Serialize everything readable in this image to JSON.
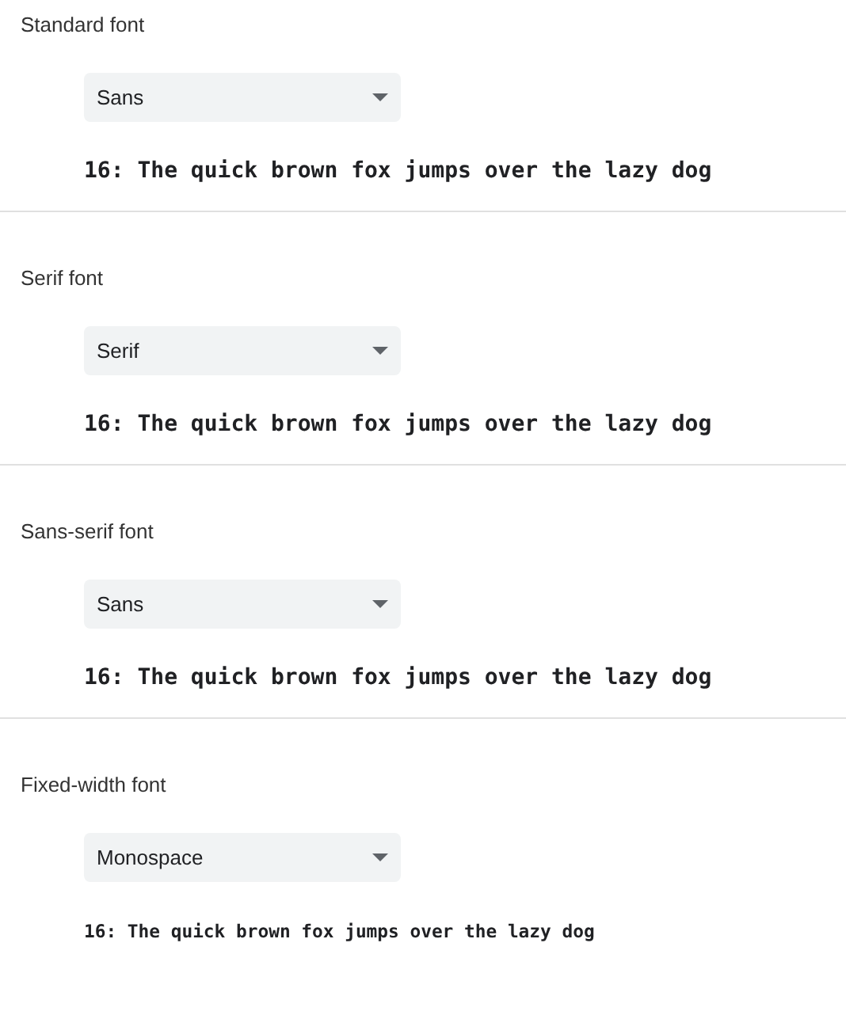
{
  "sections": [
    {
      "label": "Standard font",
      "dropdown": {
        "value": "Sans"
      },
      "sample": {
        "kind": "regular",
        "text": "16: The quick brown fox jumps over the lazy dog"
      }
    },
    {
      "label": "Serif font",
      "dropdown": {
        "value": "Serif"
      },
      "sample": {
        "kind": "regular",
        "text": "16: The quick brown fox jumps over the lazy dog"
      }
    },
    {
      "label": "Sans-serif font",
      "dropdown": {
        "value": "Sans"
      },
      "sample": {
        "kind": "regular",
        "text": "16: The quick brown fox jumps over the lazy dog"
      }
    },
    {
      "label": "Fixed-width font",
      "dropdown": {
        "value": "Monospace"
      },
      "sample": {
        "kind": "fixed",
        "text": "16: The quick brown fox jumps over the lazy dog"
      }
    }
  ]
}
